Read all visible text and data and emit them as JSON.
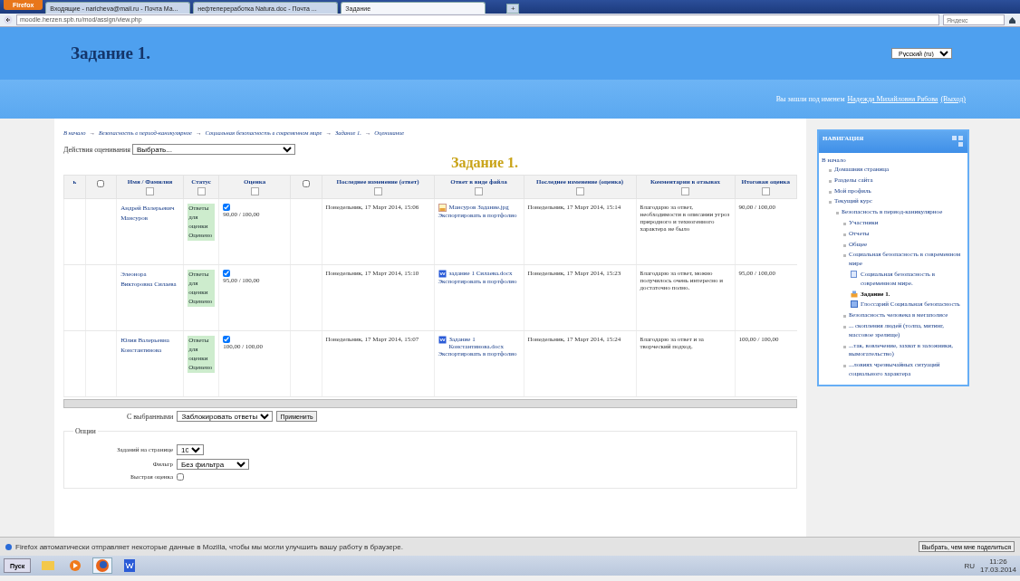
{
  "browser": {
    "menu_button": "Firefox",
    "tabs": [
      {
        "label": "Входящие - naricheva@mail.ru - Почта Ma...",
        "selected": false
      },
      {
        "label": "нефтепереработка Natura.doc - Почта ...",
        "selected": false
      },
      {
        "label": "Задание",
        "selected": true
      }
    ],
    "new_tab": "+",
    "address": "moodle.herzen.spb.ru/mod/assign/view.php",
    "search_placeholder": "Яндекс"
  },
  "header": {
    "title": "Задание 1.",
    "language": "Русский (ru)",
    "login_text": "Вы зашли под именем",
    "user": "Надежда Михайловна Рябова",
    "logout": "(Выход)"
  },
  "breadcrumb_separator": "→",
  "breadcrumb": [
    "В начало",
    "Безопасность в период-каникулярное",
    "Социальная безопасность в современном мире",
    "Задание 1.",
    "Оценивание"
  ],
  "grading_action": {
    "label": "Действия оценивания",
    "value": "Выбрать..."
  },
  "assignment_title": "Задание 1.",
  "table": {
    "columns": [
      {
        "kind": "plain",
        "label": "ь"
      },
      {
        "kind": "select",
        "checked": false
      },
      {
        "kind": "collapsible",
        "label": "Имя / Фамилия",
        "collapsed": false
      },
      {
        "kind": "collapsible",
        "label": "Статус",
        "collapsed": false
      },
      {
        "kind": "collapsible",
        "label": "Оценка",
        "collapsed": false
      },
      {
        "kind": "select",
        "checked": false
      },
      {
        "kind": "collapsible",
        "label": "Последнее изменение (ответ)",
        "collapsed": false
      },
      {
        "kind": "collapsible",
        "label": "Ответ в виде файла",
        "collapsed": false
      },
      {
        "kind": "collapsible",
        "label": "Последнее изменение (оценка)",
        "collapsed": false
      },
      {
        "kind": "collapsible",
        "label": "Комментарии в отзывах",
        "collapsed": false
      },
      {
        "kind": "collapsible",
        "label": "Итоговая оценка",
        "collapsed": false
      }
    ],
    "rows": [
      {
        "name": "Андрей Валерьевич Мансуров",
        "status": "Ответы для оценки Оценено",
        "grade": "90,00 / 100,00",
        "grade_checked": true,
        "modified": "Понедельник, 17 Март 2014, 15:06",
        "file": "Мансуров Задание.jpg",
        "kind": "image",
        "export": "Экспортировать в портфолио",
        "graded": "Понедельник, 17 Март 2014, 15:14",
        "comment": "Благодарю за ответ, необходимости в описании угроз природного и техногенного характера не было",
        "final": "90,00 / 100,00"
      },
      {
        "name": "Элеонора Викторовна Силаева",
        "status": "Ответы для оценки Оценено",
        "grade": "95,00 / 100,00",
        "grade_checked": true,
        "modified": "Понедельник, 17 Март 2014, 15:10",
        "file": "задание 1 Силаева.docx",
        "kind": "doc",
        "export": "Экспортировать в портфолио",
        "graded": "Понедельник, 17 Март 2014, 15:23",
        "comment": "Благодарю за ответ, можно получилось очень интересно и достаточно полно.",
        "final": "95,00 / 100,00"
      },
      {
        "name": "Юлия Валерьевна Константинова",
        "status": "Ответы для оценки Оценено",
        "grade": "100,00 / 100,00",
        "grade_checked": true,
        "modified": "Понедельник, 17 Март 2014, 15:07",
        "file": "Задание 1 Константинова.docx",
        "kind": "doc",
        "export": "Экспортировать в портфолио",
        "graded": "Понедельник, 17 Март 2014, 15:24",
        "comment": "Благодарю за ответ и за творческий подход.",
        "final": "100,00 / 100,00"
      }
    ]
  },
  "bulk": {
    "label": "С выбранными",
    "value": "Заблокировать ответы",
    "button": "Применить"
  },
  "options": {
    "legend": "Опции",
    "per_page_label": "Заданий на странице",
    "per_page": "10",
    "filter_label": "Фильтр",
    "filter": "Без фильтра",
    "quick_grading_label": "Быстрая оценка",
    "quick_grading": false
  },
  "navigation": {
    "title": "НАВИГАЦИЯ",
    "home": "В начало",
    "items": [
      {
        "label": "Домашняя страница",
        "kind": "node",
        "current": false
      },
      {
        "label": "Разделы сайта",
        "kind": "node",
        "current": false
      },
      {
        "label": "Мой профиль",
        "kind": "node",
        "current": false
      },
      {
        "label": "Текущий курс",
        "kind": "node",
        "current": false,
        "children": [
          {
            "label": "Безопасность в период-каникулярное",
            "kind": "node",
            "current": false,
            "children": [
              {
                "label": "Участники",
                "kind": "node",
                "current": false
              },
              {
                "label": "Отчеты",
                "kind": "node",
                "current": false
              },
              {
                "label": "Общее",
                "kind": "node",
                "current": false
              },
              {
                "label": "Социальная безопасность в современном мире",
                "kind": "node",
                "current": false,
                "children": [
                  {
                    "label": "Социальная безопасность в современном мире.",
                    "kind": "page",
                    "current": false
                  },
                  {
                    "label": "Задание 1.",
                    "kind": "assign",
                    "current": true
                  },
                  {
                    "label": "Глоссарий Социальная безопасность",
                    "kind": "glossary",
                    "current": false
                  }
                ]
              },
              {
                "label": "Безопасность человека в мегаполисе",
                "kind": "node",
                "current": false
              },
              {
                "label": "... скопления людей (толпа, митинг, массовое зрелище)",
                "kind": "node",
                "current": false
              },
              {
                "label": "...так, вовлечение, захват в заложники, вымогательство)",
                "kind": "node",
                "current": false
              },
              {
                "label": "...ловиях чрезвычайных ситуаций социального характера",
                "kind": "node",
                "current": false
              }
            ]
          }
        ]
      }
    ]
  },
  "notification": {
    "text": "Firefox автоматически отправляет некоторые данные в Mozilla, чтобы мы могли улучшить вашу работу в браузере.",
    "button": "Выбрать, чем мне поделиться"
  },
  "taskbar": {
    "start": "Пуск",
    "apps": [
      {
        "kind": "folder",
        "selected": false
      },
      {
        "kind": "media",
        "selected": false
      },
      {
        "kind": "firefox",
        "selected": true
      },
      {
        "kind": "word",
        "selected": false
      }
    ],
    "lang": "RU",
    "time": "11:26",
    "date": "17.03.2014"
  }
}
